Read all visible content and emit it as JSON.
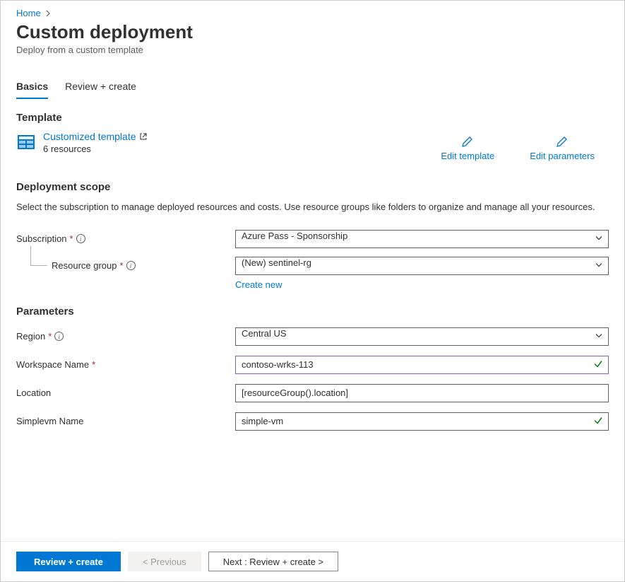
{
  "breadcrumb": {
    "home": "Home"
  },
  "page": {
    "title": "Custom deployment",
    "subtitle": "Deploy from a custom template"
  },
  "tabs": {
    "basics": "Basics",
    "review": "Review + create"
  },
  "template": {
    "section_title": "Template",
    "link_label": "Customized template",
    "resources_label": "6 resources",
    "edit_template": "Edit template",
    "edit_parameters": "Edit parameters"
  },
  "scope": {
    "title": "Deployment scope",
    "description": "Select the subscription to manage deployed resources and costs. Use resource groups like folders to organize and manage all your resources.",
    "subscription_label": "Subscription",
    "subscription_value": "Azure Pass - Sponsorship",
    "rg_label": "Resource group",
    "rg_value": "(New) sentinel-rg",
    "create_new": "Create new"
  },
  "params": {
    "title": "Parameters",
    "region_label": "Region",
    "region_value": "Central US",
    "workspace_label": "Workspace Name",
    "workspace_value": "contoso-wrks-113",
    "location_label": "Location",
    "location_value": "[resourceGroup().location]",
    "simplevm_label": "Simplevm Name",
    "simplevm_value": "simple-vm"
  },
  "footer": {
    "review": "Review + create",
    "previous": "< Previous",
    "next": "Next : Review + create >"
  }
}
